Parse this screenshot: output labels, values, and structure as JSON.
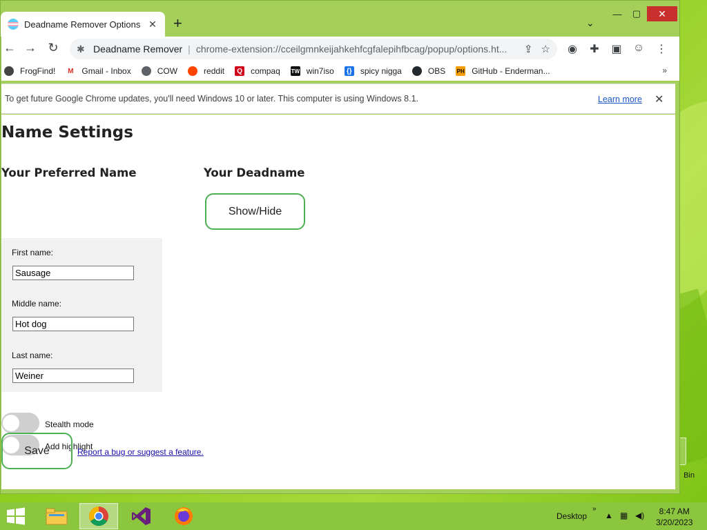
{
  "browser": {
    "tab_title": "Deadname Remover Options",
    "tab_close": "✕",
    "new_tab": "+",
    "tab_search": "⌄",
    "min": "—",
    "max": "▢",
    "close": "✕",
    "back": "←",
    "forward": "→",
    "reload": "↻",
    "omnibox_site": "Deadname Remover",
    "omnibox_sep": "|",
    "omnibox_url": "chrome-extension://cceilgmnkeijahkehfcgfalepihfbcag/popup/options.ht...",
    "bookmarks": [
      {
        "label": "FrogFind!",
        "icon": "frog-icon",
        "color": "#444444"
      },
      {
        "label": "Gmail - Inbox",
        "icon": "gmail-icon",
        "color": "#d93025"
      },
      {
        "label": "COW",
        "icon": "globe-icon",
        "color": "#5f6368"
      },
      {
        "label": "reddit",
        "icon": "reddit-icon",
        "color": "#ff4500"
      },
      {
        "label": "compaq",
        "icon": "compaq-icon",
        "color": "#d0021b"
      },
      {
        "label": "win7iso",
        "icon": "win7iso-icon",
        "color": "#111111"
      },
      {
        "label": "spicy nigga",
        "icon": "bracket-icon",
        "color": "#1a73e8"
      },
      {
        "label": "OBS",
        "icon": "github-icon",
        "color": "#24292e"
      },
      {
        "label": "GitHub - Enderman...",
        "icon": "ph-icon",
        "color": "#f59c00"
      }
    ],
    "bookmarks_more": "»",
    "infobar_text": "To get future Google Chrome updates, you'll need Windows 10 or later. This computer is using Windows 8.1.",
    "infobar_learn": "Learn more",
    "infobar_close": "✕"
  },
  "page": {
    "title": "Name Settings",
    "preferred_heading": "Your Preferred Name",
    "deadname_heading": "Your Deadname",
    "show_hide": "Show/Hide",
    "first_label": "First name:",
    "first_value": "Sausage",
    "middle_label": "Middle name:",
    "middle_value": "Hot dog",
    "last_label": "Last name:",
    "last_value": "Weiner",
    "stealth_label": "Stealth mode",
    "highlight_label": "Add highlight",
    "save": "Save",
    "report": "Report a bug or suggest a feature."
  },
  "desktop": {
    "recycle_label": "Bin"
  },
  "taskbar": {
    "desktop_label": "Desktop",
    "chevron": "»",
    "time": "8:47 AM",
    "date": "3/20/2023"
  }
}
